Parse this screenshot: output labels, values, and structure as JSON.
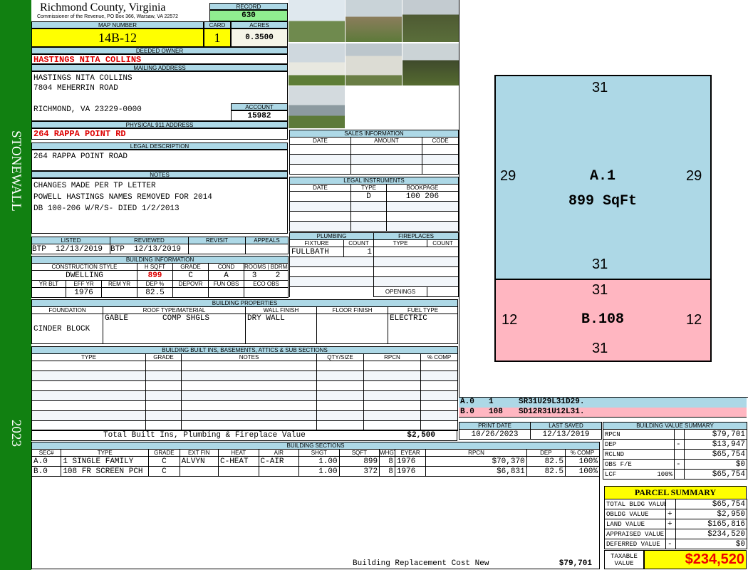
{
  "side": {
    "district": "STONEWALL",
    "year": "2023"
  },
  "header": {
    "county": "Richmond County, Virginia",
    "office": "Commissioner of the Revenue, PO Box 366, Warsaw, VA 22572",
    "record_label": "RECORD",
    "record": "630"
  },
  "map": {
    "map_label": "MAP NUMBER",
    "map_number": "14B-12",
    "card_label": "CARD",
    "card": "1",
    "acres_label": "ACRES",
    "acres": "0.3500"
  },
  "owner": {
    "label": "DEEDED OWNER",
    "name": "HASTINGS NITA COLLINS"
  },
  "mailing": {
    "label": "MAILING ADDRESS",
    "line1": "HASTINGS NITA COLLINS",
    "line2": "7804 MEHERRIN ROAD",
    "line3": "RICHMOND, VA 23229-0000",
    "account_label": "ACCOUNT",
    "account": "15982"
  },
  "physical": {
    "label": "PHYSICAL 911 ADDRESS",
    "address": "264 RAPPA POINT RD"
  },
  "legal": {
    "label": "LEGAL DESCRIPTION",
    "text": "264 RAPPA POINT ROAD"
  },
  "notes": {
    "label": "NOTES",
    "lines": [
      "CHANGES MADE PER TP LETTER",
      "POWELL HASTINGS NAMES REMOVED FOR 2014",
      "DB 100-206 W/R/S- DIED 1/2/2013"
    ]
  },
  "review": {
    "listed_label": "LISTED",
    "listed": "BTP  12/13/2019",
    "reviewed_label": "REVIEWED",
    "reviewed": "BTP  12/13/2019",
    "revisit_label": "REVISIT",
    "appeals_label": "APPEALS"
  },
  "building_info": {
    "label": "BUILDING INFORMATION",
    "h1": [
      "CONSTRUCTION STYLE",
      "H SQFT",
      "GRADE",
      "COND",
      "ROOMS",
      "BDRMS"
    ],
    "v1": [
      "DWELLING",
      "899",
      "C",
      "A",
      "3",
      "2"
    ],
    "h2": [
      "YR BLT",
      "EFF YR",
      "REM YR",
      "DEP %",
      "DEPOVR",
      "FUN OBS",
      "ECO OBS"
    ],
    "v2": [
      "",
      "1976",
      "",
      "82.5",
      "",
      "",
      ""
    ]
  },
  "sales": {
    "label": "SALES INFORMATION",
    "cols": [
      "DATE",
      "AMOUNT",
      "CODE"
    ]
  },
  "legal_instruments": {
    "label": "LEGAL INSTRUMENTS",
    "cols": [
      "DATE",
      "TYPE",
      "BOOKPAGE"
    ],
    "rows": [
      [
        "",
        "D",
        "100 206"
      ]
    ]
  },
  "plumbing": {
    "label": "PLUMBING",
    "cols": [
      "FIXTURE",
      "COUNT"
    ],
    "rows": [
      [
        "FULLBATH",
        "1"
      ]
    ]
  },
  "fireplaces": {
    "label": "FIREPLACES",
    "cols": [
      "TYPE",
      "COUNT"
    ],
    "openings_label": "OPENINGS"
  },
  "properties": {
    "label": "BUILDING PROPERTIES",
    "cols": [
      "FOUNDATION",
      "ROOF TYPE/MATERIAL",
      "WALL FINISH",
      "FLOOR FINISH",
      "FUEL TYPE"
    ],
    "foundation": "CINDER BLOCK",
    "roof_type": "GABLE",
    "roof_material": "COMP SHGLS",
    "wall": "DRY WALL",
    "floor": "",
    "fuel": "ELECTRIC"
  },
  "builtins": {
    "label": "BUILDING BUILT INS, BASEMENTS, ATTICS & SUB SECTIONS",
    "cols": [
      "TYPE",
      "GRADE",
      "NOTES",
      "QTY/SIZE",
      "RPCN",
      "% COMP"
    ],
    "total_label": "Total Built Ins, Plumbing & Fireplace Value",
    "total": "$2,500"
  },
  "sections": {
    "label": "BUILDING SECTIONS",
    "cols": [
      "SEC#",
      "TYPE",
      "GRADE",
      "EXT FIN",
      "HEAT",
      "AIR",
      "SHGT",
      "SQFT",
      "WHGT",
      "EYEAR",
      "RPCN",
      "DEP",
      "% COMP"
    ],
    "rows": [
      [
        "A.0",
        "1 SINGLE FAMILY",
        "C",
        "ALVYN",
        "C-HEAT",
        "C-AIR",
        "1.00",
        "899",
        "8",
        "1976",
        "$70,370",
        "82.5",
        "100%"
      ],
      [
        "B.0",
        "108 FR SCREEN PCH",
        "C",
        "",
        "",
        "",
        "1.00",
        "372",
        "8",
        "1976",
        "$6,831",
        "82.5",
        "100%"
      ]
    ],
    "footer_label": "Building Replacement Cost New",
    "footer_value": "$79,701"
  },
  "sketch": {
    "a": {
      "label": "A.1",
      "area": "899 SqFt",
      "top": "31",
      "bottom": "31",
      "left": "29",
      "right": "29"
    },
    "b": {
      "label": "B.108",
      "top": "31",
      "bottom": "31",
      "left": "12",
      "right": "12"
    },
    "legend": [
      [
        "A.0",
        "1",
        "SR31U29L31D29."
      ],
      [
        "B.0",
        "108",
        "SD12R31U12L31."
      ]
    ],
    "colors": {
      "a": "#add8e6",
      "b": "#ffb6c1"
    }
  },
  "dates": {
    "print_label": "PRINT DATE",
    "print": "10/26/2023",
    "saved_label": "LAST SAVED",
    "saved": "12/13/2019"
  },
  "bvs": {
    "label": "BUILDING VALUE SUMMARY",
    "rows": [
      [
        "RPCN",
        "",
        "",
        "$79,701"
      ],
      [
        "DEP",
        "",
        "-",
        "$13,947"
      ],
      [
        "RCLND",
        "",
        "",
        "$65,754"
      ],
      [
        "OBS F/E",
        "",
        "-",
        "$0"
      ],
      [
        "LCF",
        "100%",
        "",
        "$65,754"
      ]
    ]
  },
  "parcel": {
    "label": "PARCEL SUMMARY",
    "rows": [
      [
        "TOTAL BLDG VALUE",
        "",
        "$65,754"
      ],
      [
        "OBLDG VALUE",
        "+",
        "$2,950"
      ],
      [
        "LAND VALUE",
        "+",
        "$165,816"
      ],
      [
        "APPRAISED VALUE",
        "",
        "$234,520"
      ],
      [
        "DEFERRED VALUE",
        "-",
        "$0"
      ]
    ],
    "taxable_label": "TAXABLE VALUE",
    "taxable": "$234,520"
  }
}
